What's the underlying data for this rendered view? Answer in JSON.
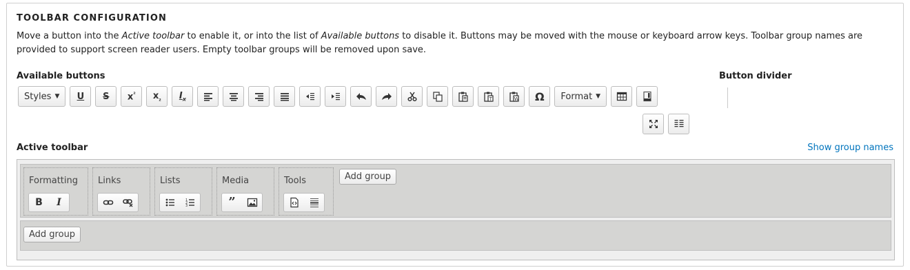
{
  "section": {
    "title": "TOOLBAR CONFIGURATION",
    "desc_part1": "Move a button into the ",
    "desc_em1": "Active toolbar",
    "desc_part2": " to enable it, or into the list of ",
    "desc_em2": "Available buttons",
    "desc_part3": " to disable it. Buttons may be moved with the mouse or keyboard arrow keys. Toolbar group names are provided to support screen reader users. Empty toolbar groups will be removed upon save."
  },
  "available": {
    "label": "Available buttons",
    "styles_label": "Styles",
    "format_label": "Format",
    "buttons": [
      {
        "name": "styles-dropdown",
        "icon": "caret-down-icon"
      },
      {
        "name": "underline",
        "icon": "underline-icon"
      },
      {
        "name": "strikethrough",
        "icon": "strikethrough-icon"
      },
      {
        "name": "superscript",
        "icon": "superscript-icon"
      },
      {
        "name": "subscript",
        "icon": "subscript-icon"
      },
      {
        "name": "remove-format",
        "icon": "remove-format-icon"
      },
      {
        "name": "align-left",
        "icon": "align-left-icon"
      },
      {
        "name": "align-center",
        "icon": "align-center-icon"
      },
      {
        "name": "align-right",
        "icon": "align-right-icon"
      },
      {
        "name": "justify",
        "icon": "justify-icon"
      },
      {
        "name": "outdent",
        "icon": "outdent-icon"
      },
      {
        "name": "indent",
        "icon": "indent-icon"
      },
      {
        "name": "undo",
        "icon": "undo-icon"
      },
      {
        "name": "redo",
        "icon": "redo-icon"
      },
      {
        "name": "cut",
        "icon": "scissors-icon"
      },
      {
        "name": "copy",
        "icon": "copy-icon"
      },
      {
        "name": "paste",
        "icon": "paste-icon"
      },
      {
        "name": "paste-text",
        "icon": "paste-text-icon"
      },
      {
        "name": "paste-word",
        "icon": "paste-word-icon"
      },
      {
        "name": "special-char",
        "icon": "omega-icon"
      },
      {
        "name": "format-dropdown",
        "icon": "caret-down-icon"
      },
      {
        "name": "table",
        "icon": "table-icon"
      },
      {
        "name": "show-blocks",
        "icon": "show-blocks-icon"
      },
      {
        "name": "maximize",
        "icon": "maximize-icon"
      },
      {
        "name": "language",
        "icon": "language-icon"
      }
    ]
  },
  "divider": {
    "label": "Button divider"
  },
  "active": {
    "label": "Active toolbar",
    "show_group_names": "Show group names",
    "add_group": "Add group",
    "groups": [
      {
        "name": "Formatting",
        "buttons": [
          "bold-icon",
          "italic-icon"
        ]
      },
      {
        "name": "Links",
        "buttons": [
          "link-icon",
          "unlink-icon"
        ]
      },
      {
        "name": "Lists",
        "buttons": [
          "bulleted-list-icon",
          "numbered-list-icon"
        ]
      },
      {
        "name": "Media",
        "buttons": [
          "blockquote-icon",
          "image-icon"
        ]
      },
      {
        "name": "Tools",
        "buttons": [
          "source-icon",
          "horizontal-rule-icon"
        ]
      }
    ]
  }
}
